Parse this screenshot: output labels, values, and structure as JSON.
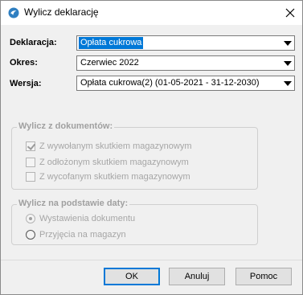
{
  "window": {
    "title": "Wylicz deklarację",
    "icon": "app-logo-icon",
    "close_icon": "close-icon"
  },
  "fields": {
    "deklaracja": {
      "label": "Deklaracja:",
      "value": "Opłata cukrowa"
    },
    "okres": {
      "label": "Okres:",
      "value": "Czerwiec 2022"
    },
    "wersja": {
      "label": "Wersja:",
      "value": "Opłata cukrowa(2) (01-05-2021 - 31-12-2030)"
    }
  },
  "documents_group": {
    "legend": "Wylicz z dokumentów:",
    "options": [
      {
        "label": "Z wywołanym skutkiem magazynowym",
        "checked": true
      },
      {
        "label": "Z odłożonym skutkiem magazynowym",
        "checked": false
      },
      {
        "label": "Z wycofanym skutkiem magazynowym",
        "checked": false
      }
    ]
  },
  "date_group": {
    "legend": "Wylicz na podstawie daty:",
    "options": [
      {
        "label": "Wystawienia dokumentu",
        "selected": true
      },
      {
        "label": "Przyjęcia na magazyn",
        "selected": false
      }
    ]
  },
  "buttons": {
    "ok": "OK",
    "cancel": "Anuluj",
    "help": "Pomoc"
  },
  "colors": {
    "selection": "#0078d7",
    "disabled_text": "#a6a6a6",
    "dialog_bg": "#f0f0f0"
  }
}
